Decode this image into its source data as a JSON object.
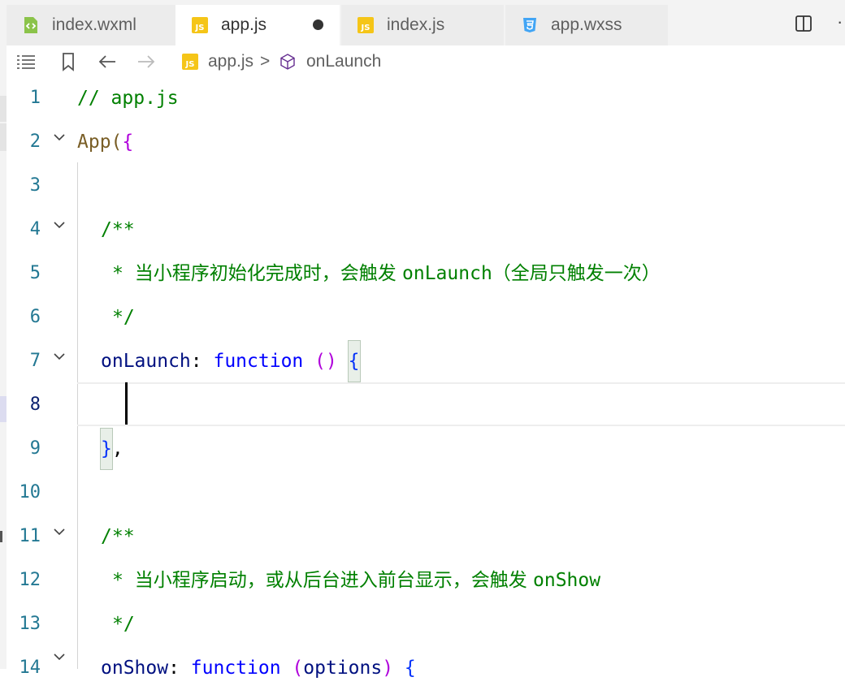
{
  "tabs": [
    {
      "label": "index.wxml",
      "icon": "wxml-file-icon",
      "active": false
    },
    {
      "label": "app.js",
      "icon": "js-file-icon",
      "active": true,
      "modified": true
    },
    {
      "label": "index.js",
      "icon": "js-file-icon",
      "active": false
    },
    {
      "label": "app.wxss",
      "icon": "css-file-icon",
      "active": false
    }
  ],
  "breadcrumb": {
    "file": "app.js",
    "symbol": "onLaunch",
    "separator": ">"
  },
  "js_icon_text": "JS",
  "lines": [
    {
      "num": "1",
      "text": "// app.js"
    },
    {
      "num": "2",
      "text": "App({"
    },
    {
      "num": "3",
      "text": ""
    },
    {
      "num": "4",
      "text": "/**"
    },
    {
      "num": "5",
      "prefix": "* ",
      "zh": "当小程序初始化完成时，会触发 ",
      "word": "onLaunch",
      "zh2": "（全局只触发一次）"
    },
    {
      "num": "6",
      "text": "*/"
    },
    {
      "num": "7",
      "prop": "onLaunch",
      "colon": ": ",
      "kw": "function",
      "paren": " () ",
      "brace": "{"
    },
    {
      "num": "8",
      "text": ""
    },
    {
      "num": "9",
      "brace": "}",
      "comma": ","
    },
    {
      "num": "10",
      "text": ""
    },
    {
      "num": "11",
      "text": "/**"
    },
    {
      "num": "12",
      "prefix": "* ",
      "zh": "当小程序启动，或从后台进入前台显示，会触发 ",
      "word": "onShow"
    },
    {
      "num": "13",
      "text": "*/"
    },
    {
      "num": "14",
      "prop": "onShow",
      "colon": ": ",
      "kw": "function",
      "paren": " (",
      "param": "options",
      "paren2": ") ",
      "brace": "{"
    }
  ],
  "app_prefix": "App(",
  "app_brace": "{",
  "colors": {
    "line_number": "#237893",
    "comment": "#008000",
    "keyword": "#0000ff",
    "property": "#001080",
    "js_icon": "#f5c518",
    "css_icon": "#42a5f5",
    "wxml_icon": "#8bc34a"
  }
}
